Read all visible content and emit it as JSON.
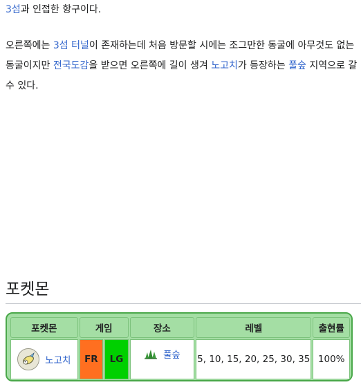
{
  "paragraph1": {
    "link1": "3섬",
    "text1": "과 인접한 항구이다."
  },
  "paragraph2": {
    "text1": "오른쪽에는 ",
    "link1": "3섬 터널",
    "text2": "이 존재하는데 처음 방문할 시에는 조그만한 동굴에 아무것도 없는 동굴이지만 ",
    "link2": "전국도감",
    "text3": "을 받으면 오른쪽에 길이 생겨 ",
    "link3": "노고치",
    "text4": "가 등장하는 ",
    "link4": "풀숲",
    "text5": " 지역으로 갈 수 있다."
  },
  "section": {
    "title": "포켓몬"
  },
  "table": {
    "headers": {
      "pokemon": "포켓몬",
      "game": "게임",
      "location": "장소",
      "level": "레벨",
      "rate": "출현률"
    },
    "rows": [
      {
        "pokemon_icon": "dunsparce-sprite-icon",
        "pokemon": "노고치",
        "game_fr": "FR",
        "game_lg": "LG",
        "location_icon": "grass-icon",
        "location": "풀숲",
        "levels": "5, 10, 15, 20, 25, 30, 35",
        "rate": "100%"
      }
    ]
  },
  "colors": {
    "link": "#3366cc",
    "table_header_bg": "#a4dea4",
    "table_border": "#4aa84a",
    "fr": "#ff6f20",
    "lg": "#00d000"
  }
}
